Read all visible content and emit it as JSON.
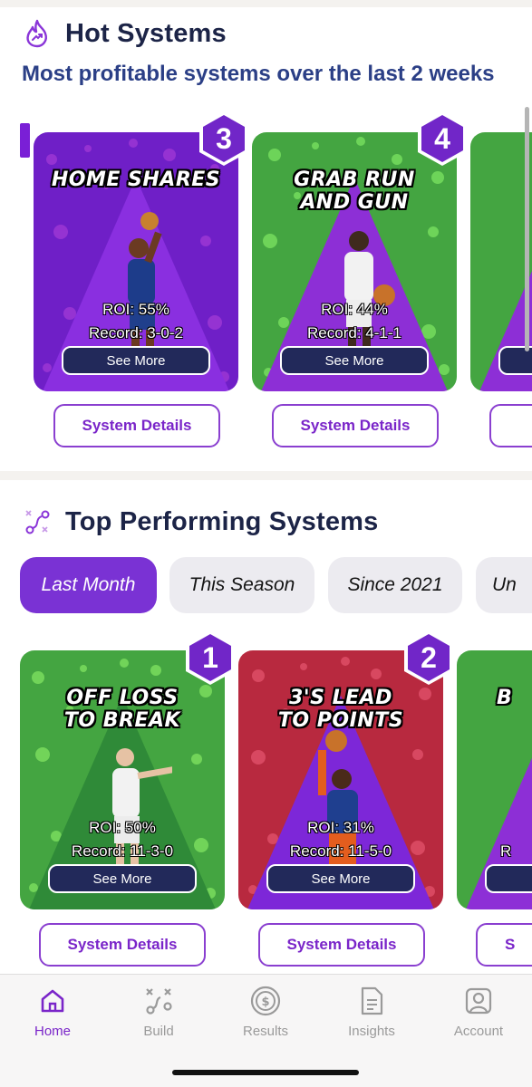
{
  "hot_systems": {
    "title": "Hot Systems",
    "subtitle": "Most profitable systems over the last 2 weeks",
    "cards": [
      {
        "rank": "3",
        "title_line1": "HOME SHARES",
        "title_line2": "",
        "roi": "ROI: 55%",
        "record": "Record: 3-0-2",
        "see_more": "See More",
        "details": "System Details",
        "color": "#6f1fc7"
      },
      {
        "rank": "4",
        "title_line1": "GRAB RUN",
        "title_line2": "AND GUN",
        "roi": "ROI: 44%",
        "record": "Record: 4-1-1",
        "see_more": "See More",
        "details": "System Details",
        "color": "#44a541"
      }
    ]
  },
  "top_performing": {
    "title": "Top Performing Systems",
    "filters": [
      "Last Month",
      "This Season",
      "Since 2021",
      "Un"
    ],
    "active_filter": "Last Month",
    "cards": [
      {
        "rank": "1",
        "title_line1": "OFF LOSS",
        "title_line2": "TO BREAK",
        "roi": "ROI: 50%",
        "record": "Record: 11-3-0",
        "see_more": "See More",
        "details": "System Details",
        "color": "#44a541"
      },
      {
        "rank": "2",
        "title_line1": "3'S LEAD",
        "title_line2": "TO POINTS",
        "roi": "ROI: 31%",
        "record": "Record: 11-5-0",
        "see_more": "See More",
        "details": "System Details",
        "color": "#b8293f"
      }
    ],
    "partial_title_letter": "B",
    "partial_details_letter": "S"
  },
  "partial_cards": {
    "hot_next_details": "",
    "top_next_record": "R"
  },
  "nav": {
    "items": [
      {
        "label": "Home",
        "icon": "home-icon",
        "active": true
      },
      {
        "label": "Build",
        "icon": "build-icon",
        "active": false
      },
      {
        "label": "Results",
        "icon": "results-icon",
        "active": false
      },
      {
        "label": "Insights",
        "icon": "insights-icon",
        "active": false
      },
      {
        "label": "Account",
        "icon": "account-icon",
        "active": false
      }
    ]
  },
  "colors": {
    "accent": "#7a25c9",
    "title_navy": "#1c2447",
    "subtitle_blue": "#2b3f86"
  }
}
